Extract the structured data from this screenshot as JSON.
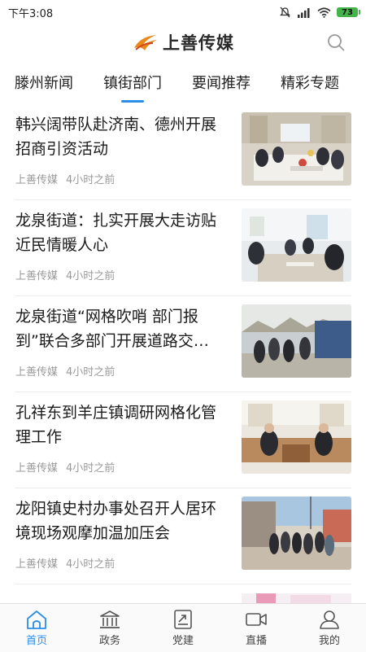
{
  "status_bar": {
    "time": "下午3:08",
    "battery": "73"
  },
  "header": {
    "logo_text": "上善传媒"
  },
  "tabs": [
    {
      "label": "滕州新闻",
      "active": false
    },
    {
      "label": "镇街部门",
      "active": true
    },
    {
      "label": "要闻推荐",
      "active": false
    },
    {
      "label": "精彩专题",
      "active": false
    }
  ],
  "news": [
    {
      "title": "韩兴阔带队赴济南、德州开展招商引资活动",
      "source": "上善传媒",
      "time": "4小时之前"
    },
    {
      "title": "龙泉街道：扎实开展大走访贴近民情暖人心",
      "source": "上善传媒",
      "time": "4小时之前"
    },
    {
      "title": "龙泉街道“网格吹哨 部门报到”联合多部门开展道路交…",
      "source": "上善传媒",
      "time": "4小时之前"
    },
    {
      "title": "孔祥东到羊庄镇调研网格化管理工作",
      "source": "上善传媒",
      "time": "4小时之前"
    },
    {
      "title": "龙阳镇史村办事处召开人居环境现场观摩加温加压会",
      "source": "上善传媒",
      "time": "4小时之前"
    }
  ],
  "bottom_nav": [
    {
      "label": "首页",
      "icon": "home-icon",
      "active": true
    },
    {
      "label": "政务",
      "icon": "government-building-icon",
      "active": false
    },
    {
      "label": "党建",
      "icon": "party-building-icon",
      "active": false
    },
    {
      "label": "直播",
      "icon": "video-camera-icon",
      "active": false
    },
    {
      "label": "我的",
      "icon": "user-icon",
      "active": false
    }
  ],
  "colors": {
    "accent": "#2a8ee8",
    "meta_text": "#9a9a9a",
    "battery": "#43b34a"
  }
}
